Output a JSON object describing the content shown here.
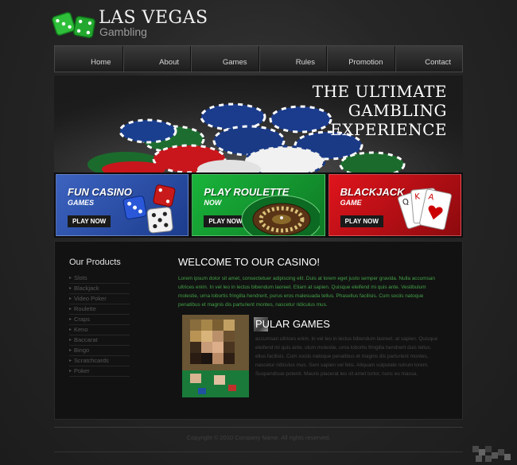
{
  "logo": {
    "title": "LAS VEGAS",
    "subtitle": "Gambling",
    "icon": "green-dice-icon"
  },
  "nav": {
    "items": [
      {
        "label": "Home"
      },
      {
        "label": "About"
      },
      {
        "label": "Games"
      },
      {
        "label": "Rules"
      },
      {
        "label": "Promotion"
      },
      {
        "label": "Contact"
      }
    ]
  },
  "banner": {
    "line1": "THE ULTIMATE",
    "line2": "GAMBLING",
    "line3": "EXPERIENCE",
    "image": "casino-chips-pile"
  },
  "promos": [
    {
      "title": "FUN CASINO",
      "subtitle": "GAMES",
      "button": "PLAY NOW",
      "color": "#2f55b0",
      "icon": "dice-icon"
    },
    {
      "title": "PLAY ROULETTE",
      "subtitle": "NOW",
      "button": "PLAY NOW",
      "color": "#16a335",
      "icon": "roulette-wheel-icon"
    },
    {
      "title": "BLACKJACK",
      "subtitle": "GAME",
      "button": "PLAY NOW",
      "color": "#cc1018",
      "icon": "playing-cards-icon"
    }
  ],
  "sidebar": {
    "title": "Our Products",
    "items": [
      "Slots",
      "Blackjack",
      "Video Poker",
      "Roulette",
      "Craps",
      "Keno",
      "Baccarat",
      "Bingo",
      "Scratchcards",
      "Poker"
    ]
  },
  "main": {
    "welcome_title": "WELCOME TO OUR CASINO!",
    "welcome_text": "Lorem ipsum dolor sit amet, consectetuer adipiscing elit. Duis at lorem eget justo semper gravida. Nulla accumsan ultrices enim. In vel leo in lectus bibendum laoreet. Etiam at sapien. Quisque eleifend mi quis ante. Vestibulum molestie, urna lobortis fringilla hendrerit, purus eros malesuada tellus. Phasellus facilisis. Cum sociis natoque penatibus et magnis dis parturient montes, nascetur ridiculus mus.",
    "popular_title": "PULAR GAMES",
    "popular_text": "accumsan ultrices enim. In vel leo in lectus bibendum laoreet. at sapien. Quisque eleifend mi quis ante. ulum molestie, urna lobortis fringilla hendrerit duis tellus. ellus facilisis. Cum sociis natoque penatibus et magnis dis parturient montes, nascetur ridiculus mus. Sem sapien vel felis. Aliquam vulputate rutrum lorem. Suspendisse potenti. Mauris placerat leo sit amet tortor, nunc eu massa."
  },
  "footer": {
    "copyright": "Copyright © 2010 Company Name. All rights reserved."
  },
  "colors": {
    "background": "#262626",
    "welcome_text": "#43a047",
    "panel": "#121212"
  }
}
